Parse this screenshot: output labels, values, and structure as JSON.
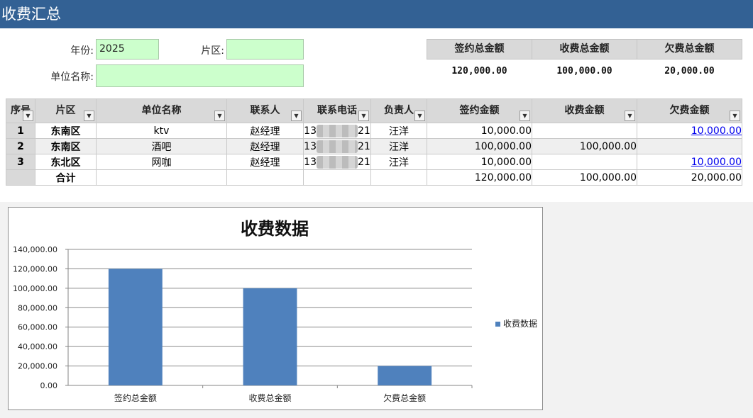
{
  "title": "收费汇总",
  "form": {
    "year_label": "年份:",
    "year_value": "2025",
    "area_label": "片区:",
    "area_value": "",
    "unit_label": "单位名称:",
    "unit_value": ""
  },
  "summary": {
    "headers": [
      "签约总金额",
      "收费总金额",
      "欠费总金额"
    ],
    "values": [
      "120,000.00",
      "100,000.00",
      "20,000.00"
    ]
  },
  "table": {
    "headers": [
      "序号",
      "片区",
      "单位名称",
      "联系人",
      "联系电话",
      "负责人",
      "签约金额",
      "收费金额",
      "欠费金额"
    ],
    "rows": [
      {
        "idx": "1",
        "area": "东南区",
        "unit": "ktv",
        "contact": "赵经理",
        "phone_prefix": "13",
        "phone_suffix": "21",
        "owner": "汪洋",
        "signed": "10,000.00",
        "paid": "",
        "owed": "10,000.00"
      },
      {
        "idx": "2",
        "area": "东南区",
        "unit": "酒吧",
        "contact": "赵经理",
        "phone_prefix": "13",
        "phone_suffix": "21",
        "owner": "汪洋",
        "signed": "100,000.00",
        "paid": "100,000.00",
        "owed": ""
      },
      {
        "idx": "3",
        "area": "东北区",
        "unit": "网咖",
        "contact": "赵经理",
        "phone_prefix": "13",
        "phone_suffix": "21",
        "owner": "汪洋",
        "signed": "10,000.00",
        "paid": "",
        "owed": "10,000.00"
      }
    ],
    "total": {
      "label": "合计",
      "signed": "120,000.00",
      "paid": "100,000.00",
      "owed": "20,000.00"
    }
  },
  "colors": {
    "header_bar": "#336194",
    "input_bg": "#ccffcc",
    "bar": "#4f81bd",
    "link": "#0000ee"
  },
  "chart_data": {
    "type": "bar",
    "title": "收费数据",
    "categories": [
      "签约总金额",
      "收费总金额",
      "欠费总金额"
    ],
    "series": [
      {
        "name": "收费数据",
        "values": [
          120000,
          100000,
          20000
        ]
      }
    ],
    "ylim": [
      0,
      140000
    ],
    "yticks": [
      "0.00",
      "20,000.00",
      "40,000.00",
      "60,000.00",
      "80,000.00",
      "100,000.00",
      "120,000.00",
      "140,000.00"
    ],
    "grid": true,
    "legend": "right"
  }
}
